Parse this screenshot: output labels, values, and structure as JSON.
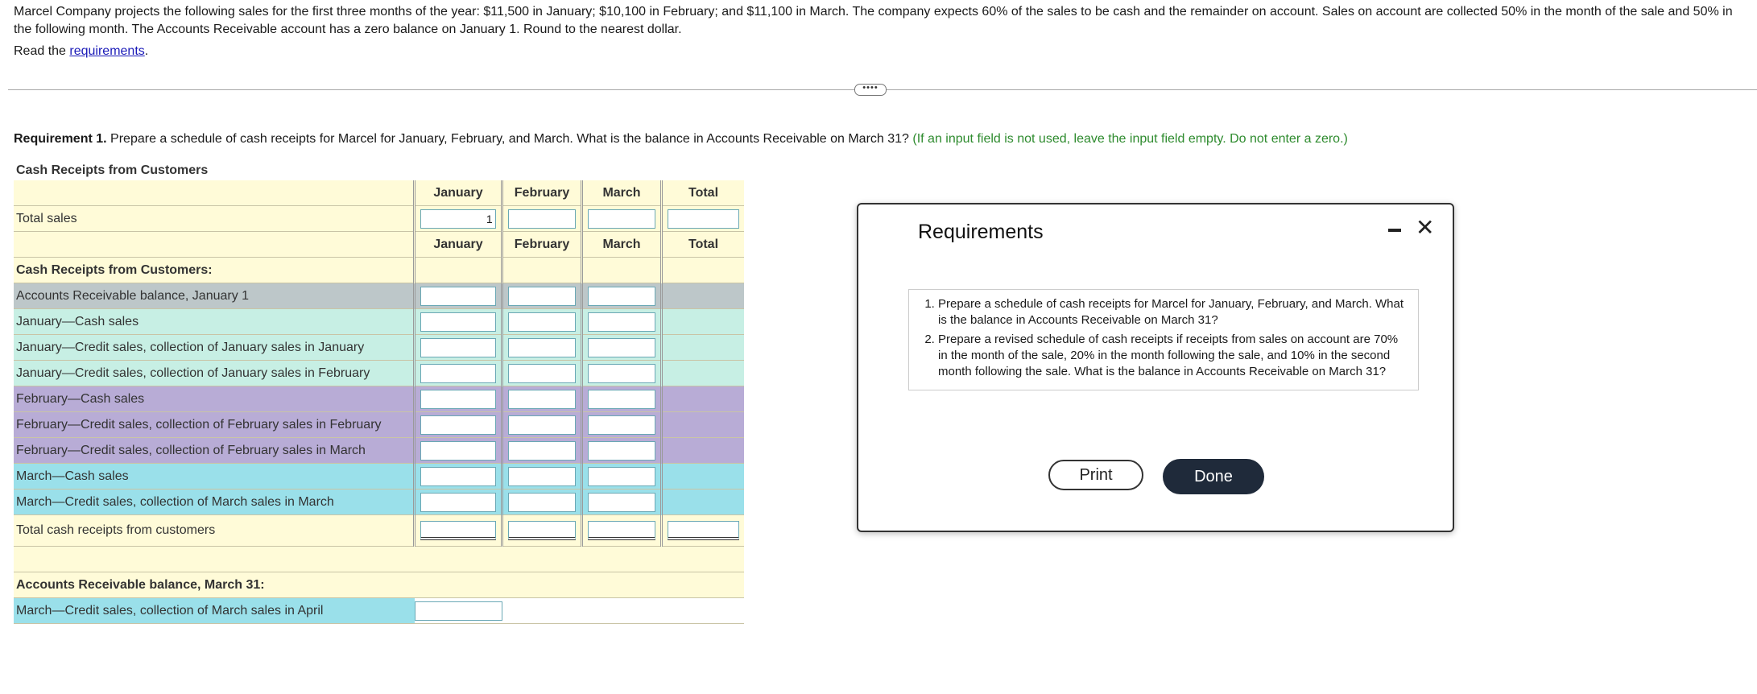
{
  "intro": {
    "text": "Marcel Company projects the following sales for the first three months of the year: $11,500 in January; $10,100 in February; and $11,100 in March. The company expects 60% of the sales to be cash and the remainder on account. Sales on account are collected 50% in the month of the sale and 50% in the following month. The Accounts Receivable account has a zero balance on January 1. Round to the nearest dollar.",
    "read_prefix": "Read the ",
    "read_link": "requirements",
    "read_suffix": "."
  },
  "more_button": "••••",
  "requirement1": {
    "bold": "Requirement 1.",
    "text": " Prepare a schedule of cash receipts for Marcel for January, February, and March. What is the balance in Accounts Receivable on March 31? ",
    "hint": "(If an input field is not used, leave the input field empty. Do not enter a zero.)"
  },
  "table": {
    "title": "Cash Receipts from Customers",
    "columns": [
      "January",
      "February",
      "March",
      "Total"
    ],
    "total_sales_label": "Total sales",
    "total_sales_values": [
      "1",
      "",
      "",
      ""
    ],
    "section_label": "Cash Receipts from Customers:",
    "rows": [
      "Accounts Receivable balance, January 1",
      "January—Cash sales",
      "January—Credit sales, collection of January sales in January",
      "January—Credit sales, collection of January sales in February",
      "February—Cash sales",
      "February—Credit sales, collection of February sales in February",
      "February—Credit sales, collection of February sales in March",
      "March—Cash sales",
      "March—Credit sales, collection of March sales in March"
    ],
    "total_receipts_label": "Total cash receipts from customers",
    "ar_section_label": "Accounts Receivable balance, March 31:",
    "ar_row_label": "March—Credit sales, collection of March sales in April"
  },
  "dialog": {
    "title": "Requirements",
    "items": [
      "Prepare a schedule of cash receipts for Marcel for January, February, and March. What is the balance in Accounts Receivable on March 31?",
      "Prepare a revised schedule of cash receipts if receipts from sales on account are 70% in the month of the sale, 20% in the month following the sale, and 10% in the second month following the sale. What is the balance in Accounts Receivable on March 31?"
    ],
    "print_label": "Print",
    "done_label": "Done",
    "close_glyph": "✕"
  },
  "colors": {
    "yellow": "#fffbd8",
    "gray": "#bdc7c9",
    "mint": "#c7efe4",
    "purple": "#b8acd6",
    "cyan": "#9ae0ea",
    "done_button": "#1f2a3a"
  }
}
